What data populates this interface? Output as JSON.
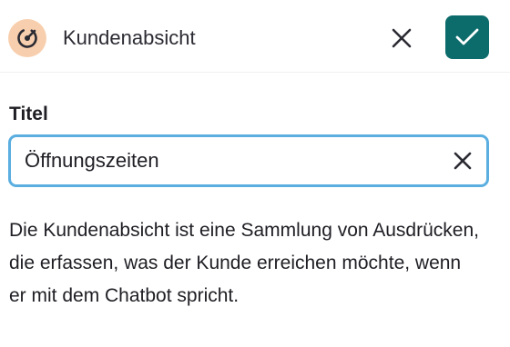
{
  "header": {
    "icon": "target-icon",
    "icon_bg_color": "#f8cfae",
    "title": "Kundenabsicht",
    "close_icon": "close-icon",
    "confirm_icon": "checkmark-icon",
    "confirm_color": "#0c6b6b"
  },
  "form": {
    "title_label": "Titel",
    "title_value": "Öffnungszeiten",
    "clear_icon": "clear-icon",
    "focus_color": "#5aaee0"
  },
  "description": "Die Kundenabsicht ist eine Sammlung von Ausdrücken, die erfassen, was der Kunde erreichen möchte, wenn er mit dem Chatbot spricht."
}
